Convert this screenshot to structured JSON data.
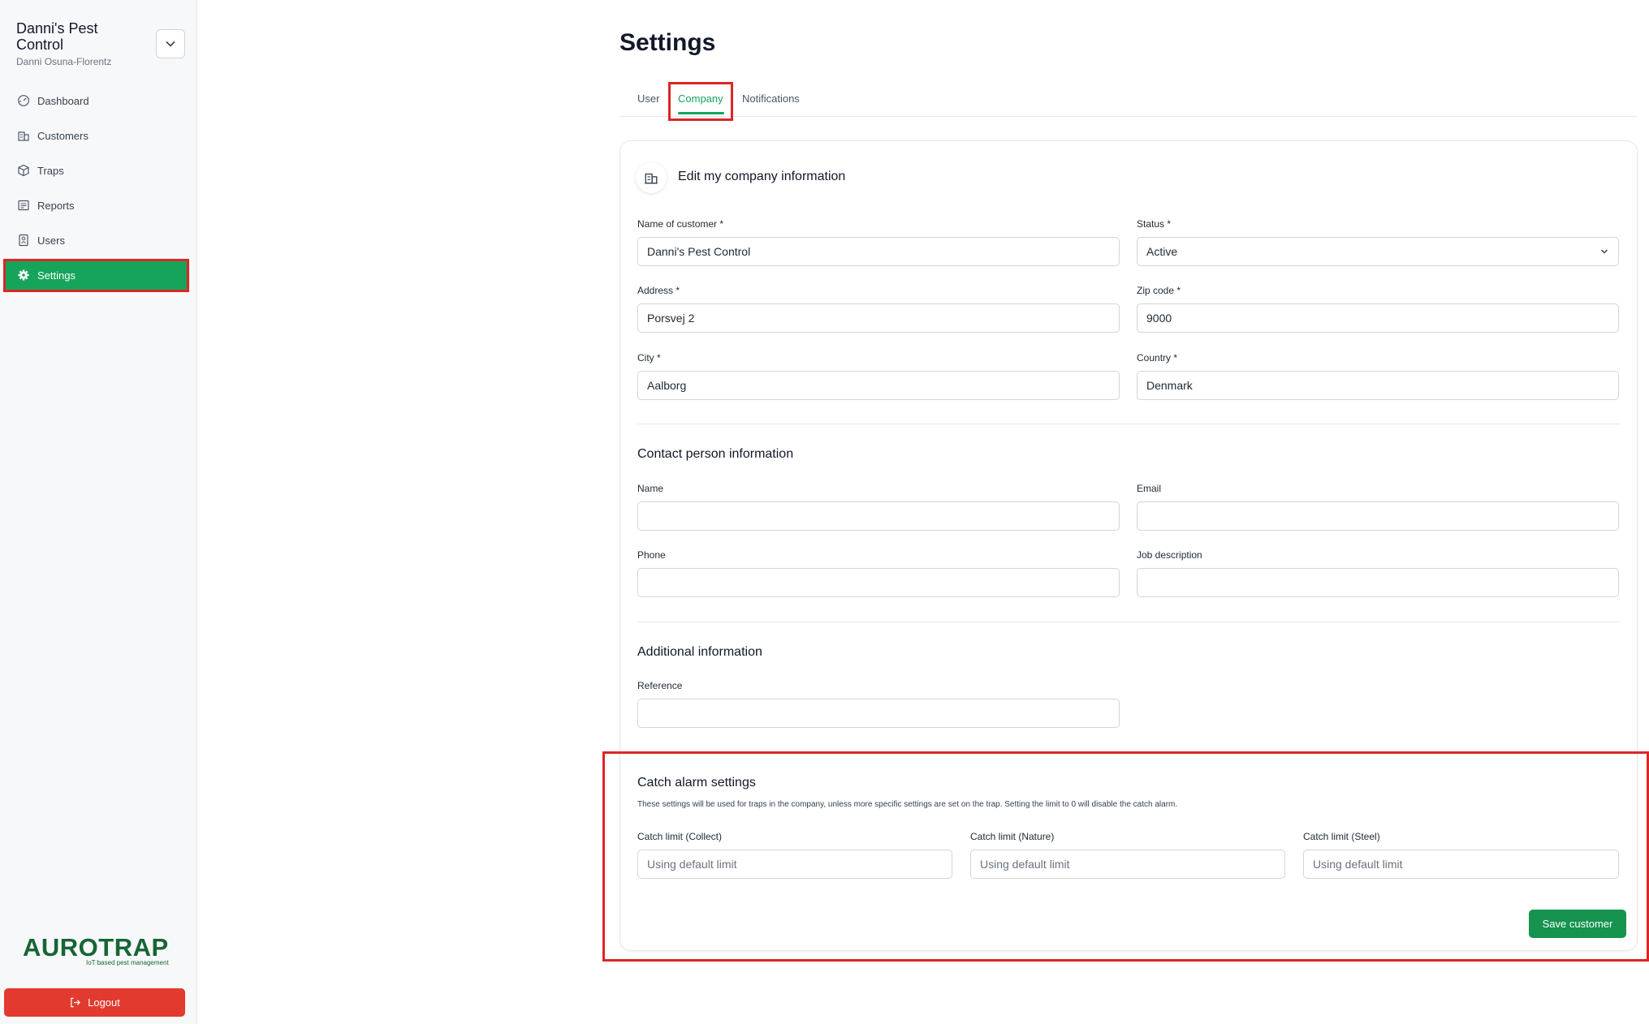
{
  "sidebar": {
    "org_name": "Danni's Pest Control",
    "org_user": "Danni Osuna-Florentz",
    "items": [
      {
        "label": "Dashboard",
        "icon": "dashboard-icon"
      },
      {
        "label": "Customers",
        "icon": "building-icon"
      },
      {
        "label": "Traps",
        "icon": "box-icon"
      },
      {
        "label": "Reports",
        "icon": "report-icon"
      },
      {
        "label": "Users",
        "icon": "users-icon"
      },
      {
        "label": "Settings",
        "icon": "gear-icon",
        "active": true
      }
    ],
    "logo_word": "AUROTRAP",
    "logo_tagline": "IoT based pest management",
    "logout_label": "Logout"
  },
  "page": {
    "title": "Settings",
    "tabs": [
      {
        "label": "User"
      },
      {
        "label": "Company",
        "active": true
      },
      {
        "label": "Notifications"
      }
    ]
  },
  "company_form": {
    "heading": "Edit my company information",
    "name_label": "Name of customer *",
    "name_value": "Danni's Pest Control",
    "status_label": "Status *",
    "status_value": "Active",
    "address_label": "Address *",
    "address_value": "Porsvej 2",
    "zip_label": "Zip code *",
    "zip_value": "9000",
    "city_label": "City *",
    "city_value": "Aalborg",
    "country_label": "Country *",
    "country_value": "Denmark"
  },
  "contact": {
    "heading": "Contact person information",
    "name_label": "Name",
    "name_value": "",
    "email_label": "Email",
    "email_value": "",
    "phone_label": "Phone",
    "phone_value": "",
    "job_label": "Job description",
    "job_value": ""
  },
  "additional": {
    "heading": "Additional information",
    "reference_label": "Reference",
    "reference_value": ""
  },
  "catch_alarm": {
    "heading": "Catch alarm settings",
    "description": "These settings will be used for traps in the company, unless more specific settings are set on the trap. Setting the limit to 0 will disable the catch alarm.",
    "collect_label": "Catch limit (Collect)",
    "nature_label": "Catch limit (Nature)",
    "steel_label": "Catch limit (Steel)",
    "placeholder": "Using default limit"
  },
  "actions": {
    "save_label": "Save customer"
  },
  "colors": {
    "accent": "#16a45a",
    "logout": "#e23a2e",
    "highlight": "#dc2626"
  }
}
